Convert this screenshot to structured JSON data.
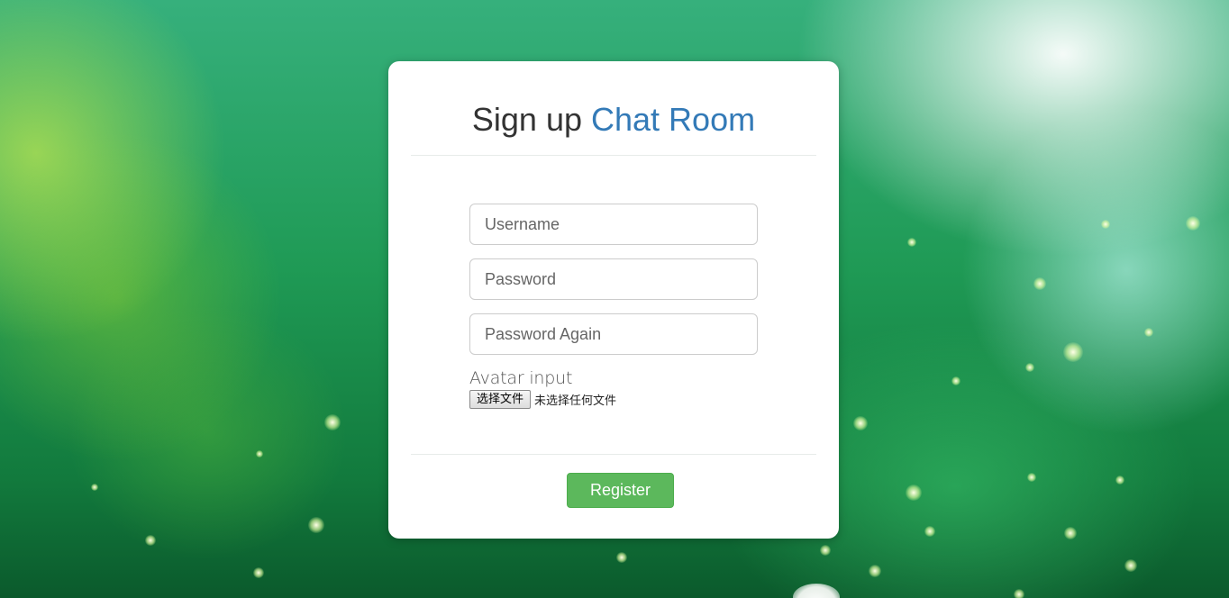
{
  "header": {
    "title_prefix": "Sign up",
    "title_accent": "Chat Room"
  },
  "form": {
    "username_placeholder": "Username",
    "password_placeholder": "Password",
    "password_again_placeholder": "Password Again",
    "avatar_label": "Avatar input",
    "file_button_label": "选择文件",
    "file_status": "未选择任何文件"
  },
  "footer": {
    "register_label": "Register"
  },
  "colors": {
    "accent": "#337ab7",
    "register_button": "#5cb85c"
  }
}
